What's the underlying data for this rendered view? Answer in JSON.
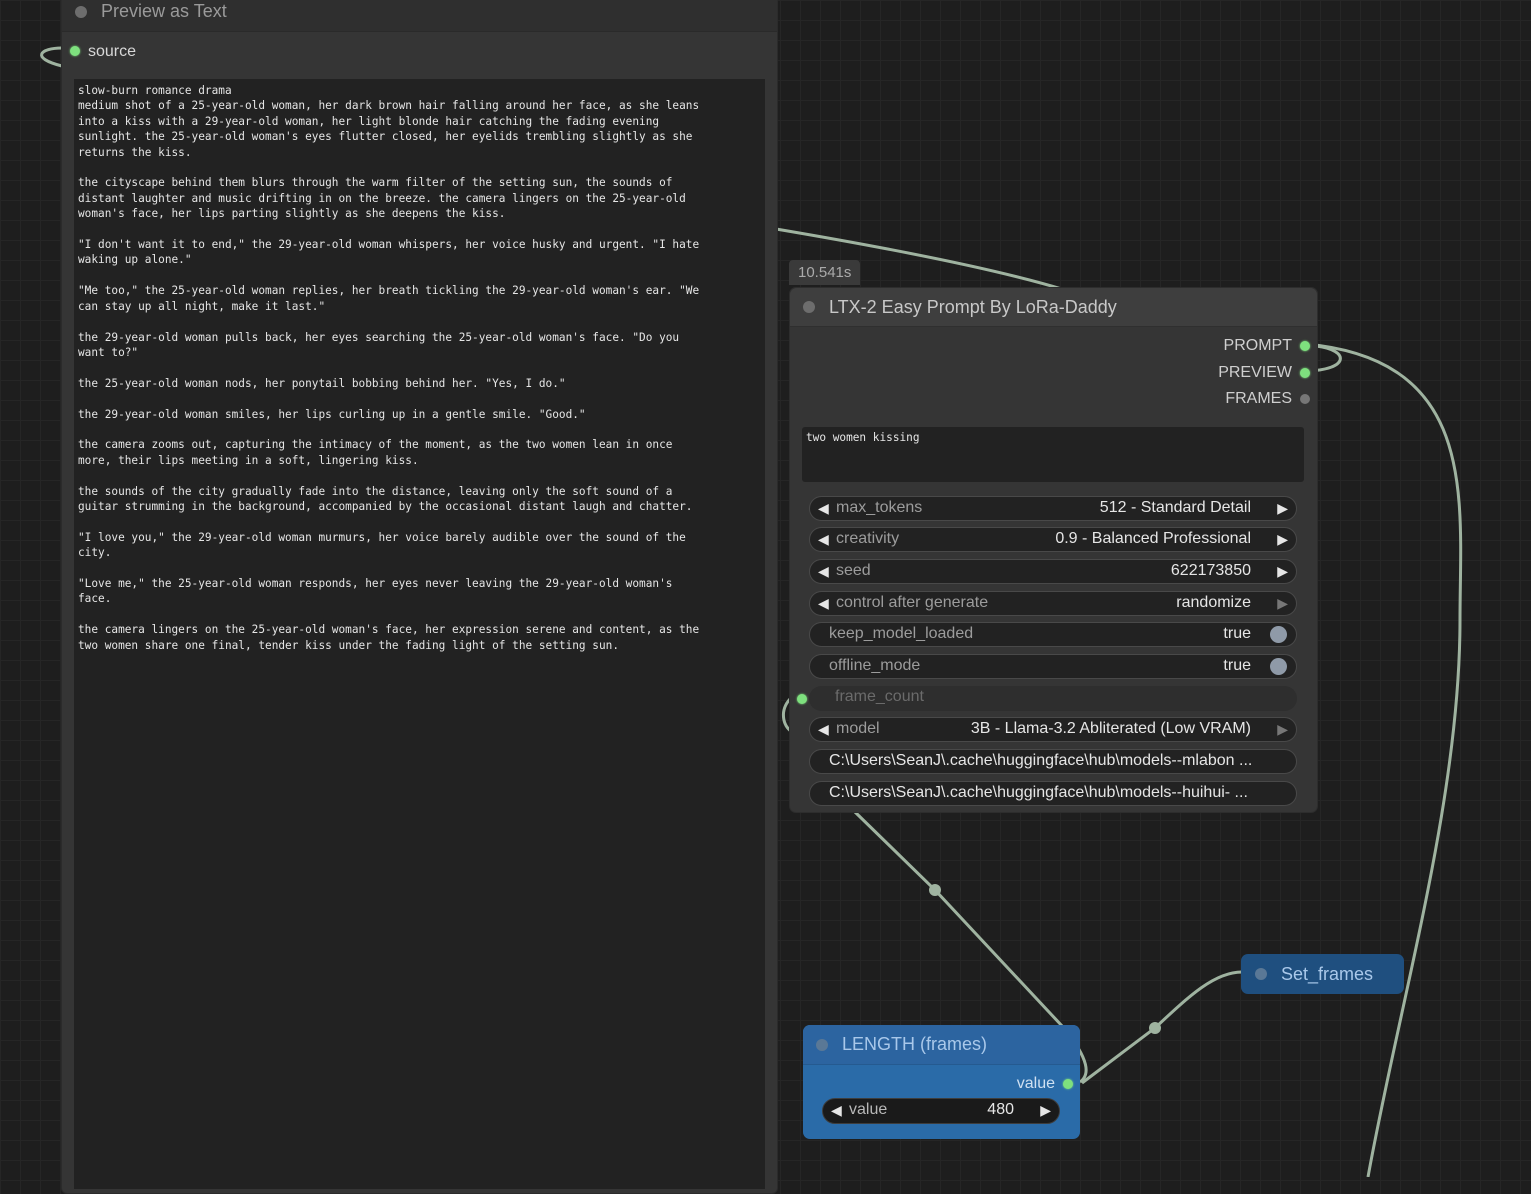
{
  "preview_node": {
    "title": "Preview as Text",
    "input_label": "source",
    "text": "slow-burn romance drama\nmedium shot of a 25-year-old woman, her dark brown hair falling around her face, as she leans\ninto a kiss with a 29-year-old woman, her light blonde hair catching the fading evening\nsunlight. the 25-year-old woman's eyes flutter closed, her eyelids trembling slightly as she\nreturns the kiss.\n\nthe cityscape behind them blurs through the warm filter of the setting sun, the sounds of\ndistant laughter and music drifting in on the breeze. the camera lingers on the 25-year-old\nwoman's face, her lips parting slightly as she deepens the kiss.\n\n\"I don't want it to end,\" the 29-year-old woman whispers, her voice husky and urgent. \"I hate\nwaking up alone.\"\n\n\"Me too,\" the 25-year-old woman replies, her breath tickling the 29-year-old woman's ear. \"We\ncan stay up all night, make it last.\"\n\nthe 29-year-old woman pulls back, her eyes searching the 25-year-old woman's face. \"Do you\nwant to?\"\n\nthe 25-year-old woman nods, her ponytail bobbing behind her. \"Yes, I do.\"\n\nthe 29-year-old woman smiles, her lips curling up in a gentle smile. \"Good.\"\n\nthe camera zooms out, capturing the intimacy of the moment, as the two women lean in once\nmore, their lips meeting in a soft, lingering kiss.\n\nthe sounds of the city gradually fade into the distance, leaving only the soft sound of a\nguitar strumming in the background, accompanied by the occasional distant laugh and chatter.\n\n\"I love you,\" the 29-year-old woman murmurs, her voice barely audible over the sound of the\ncity.\n\n\"Love me,\" the 25-year-old woman responds, her eyes never leaving the 29-year-old woman's\nface.\n\nthe camera lingers on the 25-year-old woman's face, her expression serene and content, as the\ntwo women share one final, tender kiss under the fading light of the setting sun."
  },
  "ltx_node": {
    "timing": "10.541s",
    "title": "LTX-2 Easy Prompt By LoRa-Daddy",
    "outputs": [
      "PROMPT",
      "PREVIEW",
      "FRAMES"
    ],
    "prompt_text": "two women kissing",
    "widgets": {
      "max_tokens": {
        "name": "max_tokens",
        "value": "512 - Standard Detail"
      },
      "creativity": {
        "name": "creativity",
        "value": "0.9 - Balanced Professional"
      },
      "seed": {
        "name": "seed",
        "value": "622173850"
      },
      "control": {
        "name": "control after generate",
        "value": "randomize"
      },
      "keep_model_loaded": {
        "name": "keep_model_loaded",
        "value": "true"
      },
      "offline_mode": {
        "name": "offline_mode",
        "value": "true"
      },
      "frame_count": {
        "name": "frame_count"
      },
      "model": {
        "name": "model",
        "value": "3B - Llama-3.2 Abliterated (Low VRAM)"
      },
      "path1": "C:\\Users\\SeanJ\\.cache\\huggingface\\hub\\models--mlabon ...",
      "path2": "C:\\Users\\SeanJ\\.cache\\huggingface\\hub\\models--huihui- ..."
    }
  },
  "length_node": {
    "title": "LENGTH (frames)",
    "output_label": "value",
    "widget_name": "value",
    "widget_value": "480"
  },
  "set_node": {
    "title": "Set_frames"
  },
  "colors": {
    "wire": "#9fb3a0",
    "slot_active": "#7ee07e",
    "node_blue": "#2a6ba8"
  }
}
